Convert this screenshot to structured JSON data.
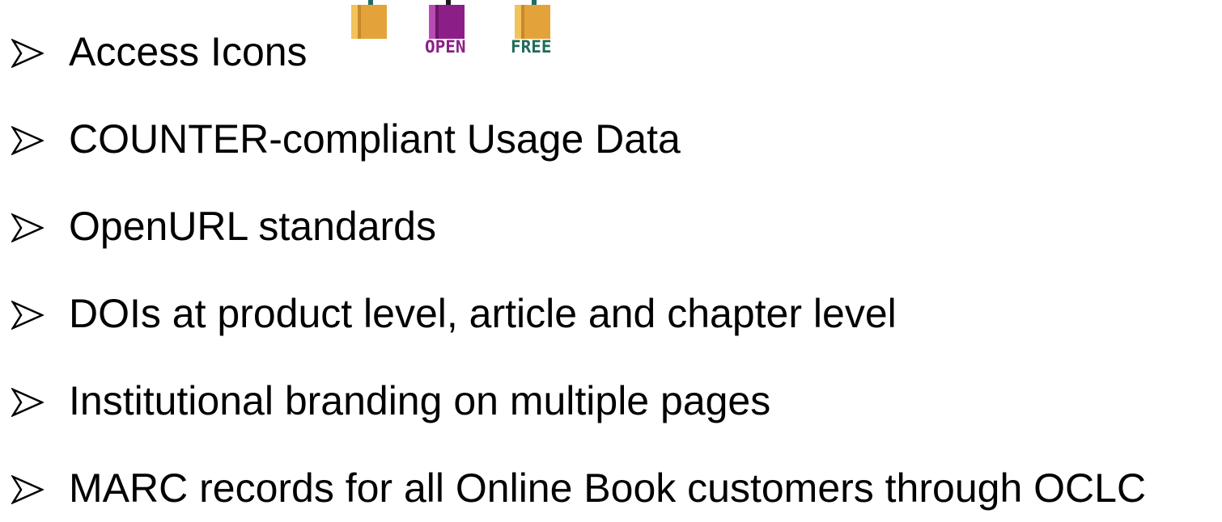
{
  "slide": {
    "bullets": [
      {
        "text": "Access Icons"
      },
      {
        "text": "COUNTER-compliant Usage Data"
      },
      {
        "text": "OpenURL standards"
      },
      {
        "text": "DOIs at product level, article and chapter level"
      },
      {
        "text": "Institutional branding on multiple pages"
      },
      {
        "text": "MARC records for all Online Book customers through OCLC"
      }
    ],
    "access_icons": [
      {
        "icon": "open-padlock-icon",
        "label": "",
        "color": "#e0a030"
      },
      {
        "icon": "open-padlock-icon",
        "label": "OPEN",
        "color": "#8c1f87"
      },
      {
        "icon": "open-padlock-icon",
        "label": "FREE",
        "color": "#e0a030"
      }
    ],
    "label_colors": {
      "open": "#8c1f87",
      "free": "#1f6b5a"
    },
    "shackle_color": "#1f6b6b"
  }
}
